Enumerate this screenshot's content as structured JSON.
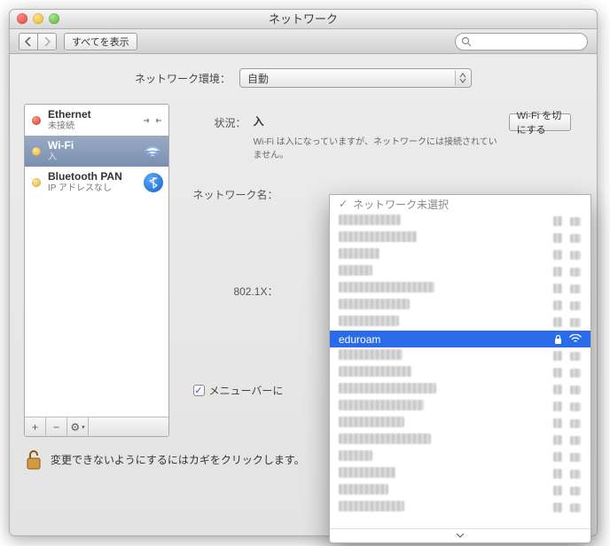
{
  "window": {
    "title": "ネットワーク"
  },
  "toolbar": {
    "back_aria": "戻る",
    "fwd_aria": "進む",
    "show_all": "すべてを表示",
    "search_placeholder": ""
  },
  "location": {
    "label": "ネットワーク環境：",
    "value": "自動"
  },
  "sidebar": {
    "items": [
      {
        "title": "Ethernet",
        "subtitle": "未接続",
        "dot": "red",
        "icon": "ethernet"
      },
      {
        "title": "Wi-Fi",
        "subtitle": "入",
        "dot": "yel",
        "icon": "wifi",
        "selected": true
      },
      {
        "title": "Bluetooth PAN",
        "subtitle": "IP アドレスなし",
        "dot": "yel",
        "icon": "bluetooth"
      }
    ],
    "footer": {
      "add": "+",
      "remove": "−",
      "gear": "⚙"
    }
  },
  "main": {
    "status_label": "状況：",
    "status_value": "入",
    "wifi_off_btn": "Wi-Fi を切にする",
    "status_desc": "Wi-Fi は入になっていますが、ネットワークには接続されていません。",
    "netname_label": "ネットワーク名：",
    "dot1x_label": "802.1X：",
    "menubar_label": "メニューバーに",
    "help_label": "?"
  },
  "lock": {
    "text": "変更できないようにするにはカギをクリックします。"
  },
  "dropdown": {
    "header": "ネットワーク未選択",
    "selected_value": "eduroam"
  }
}
